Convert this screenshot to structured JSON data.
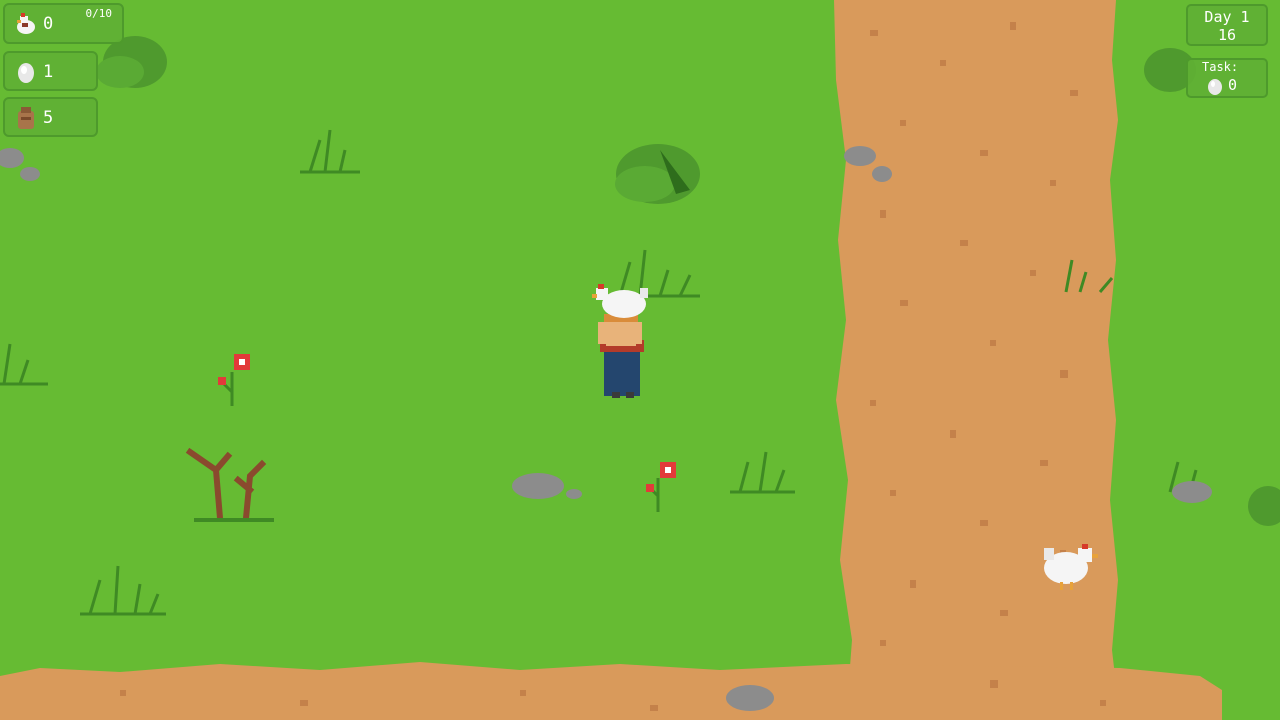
{
  "hud": {
    "chickens": {
      "value": "0",
      "capacity": "0/10",
      "icon": "chicken-icon"
    },
    "eggs": {
      "value": "1",
      "icon": "egg-icon"
    },
    "feed": {
      "value": "5",
      "icon": "feed-sack-icon"
    },
    "day": {
      "label": "Day 1",
      "time": "16"
    },
    "task": {
      "label": "Task:",
      "value": "0",
      "icon": "egg-icon"
    }
  },
  "colors": {
    "grass": "#66bb33",
    "grass_dark": "#4e9a2c",
    "dirt": "#d99a5b",
    "dirt_dark": "#c4814a",
    "rock": "#8c8c8c",
    "hud_bg": "#60b034"
  }
}
